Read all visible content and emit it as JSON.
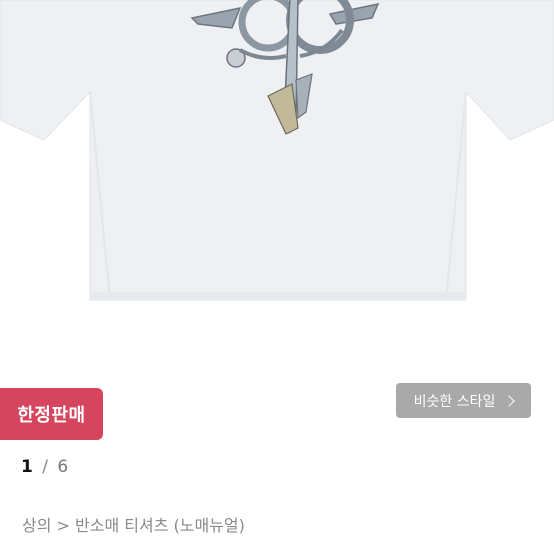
{
  "product": {
    "image_alt": "white short sleeve t-shirt with metallic emblem graphic"
  },
  "badge": {
    "label": "한정판매"
  },
  "similar_style": {
    "label": "비슷한 스타일",
    "icon": "chevron-right-icon"
  },
  "pager": {
    "current": "1",
    "separator": "/",
    "total": "6"
  },
  "breadcrumb": {
    "text": "상의 > 반소매 티셔츠 (노매뉴얼)"
  },
  "colors": {
    "badge_bg": "#d6455e",
    "button_bg": "#a9a9a9",
    "shirt": "#eef0f2"
  }
}
